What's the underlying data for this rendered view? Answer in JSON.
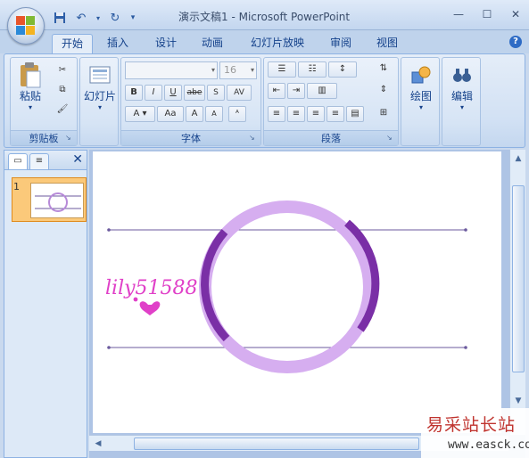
{
  "titlebar": {
    "title": "演示文稿1 - Microsoft PowerPoint"
  },
  "tabs": [
    "开始",
    "插入",
    "设计",
    "动画",
    "幻灯片放映",
    "审阅",
    "视图"
  ],
  "ribbon": {
    "clipboard": {
      "paste_label": "粘贴",
      "group_label": "剪贴板"
    },
    "slides": {
      "new_slide_label": "幻灯片",
      "group_label": ""
    },
    "font": {
      "font_size": "16",
      "group_label": "字体"
    },
    "paragraph": {
      "group_label": "段落"
    },
    "drawing": {
      "label": "绘图"
    },
    "editing": {
      "label": "编辑"
    }
  },
  "leftpane": {
    "slide_number": "1"
  },
  "slide": {
    "signature_text": "lily51588"
  },
  "colors": {
    "ring_light": "#d6aef0",
    "ring_dark": "#7a2fa6",
    "line_color": "#6b5a9e",
    "signature": "#e040c8"
  },
  "watermark": {
    "cn": "易采站长站",
    "url": "www.easck.com"
  }
}
